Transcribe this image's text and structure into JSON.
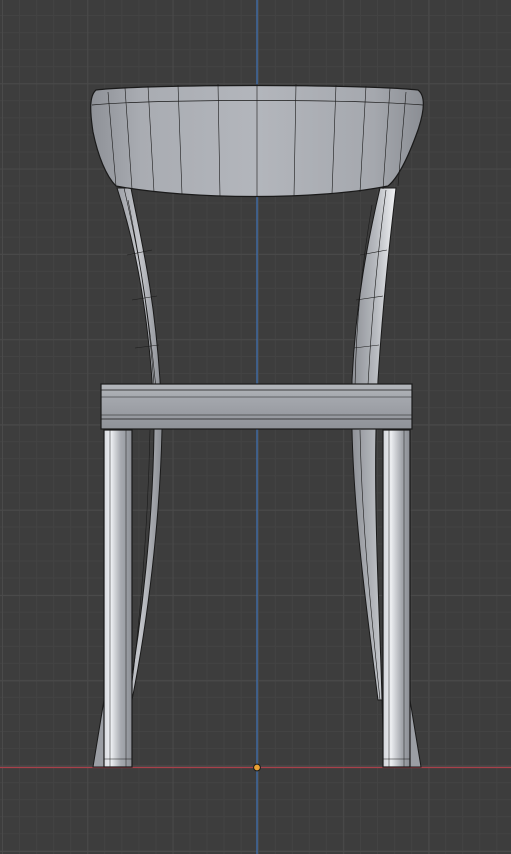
{
  "viewport": {
    "view": "front-orthographic",
    "background": "#3d3d3d",
    "grid_color": "#4a4a4a",
    "x_axis_color": "#a8404a",
    "z_axis_color": "#3f73b8",
    "origin_color": "#e8a034",
    "object": {
      "name": "chair",
      "shading": "solid",
      "wireframe_overlay": true,
      "base_color": "#a4a7ad"
    }
  }
}
